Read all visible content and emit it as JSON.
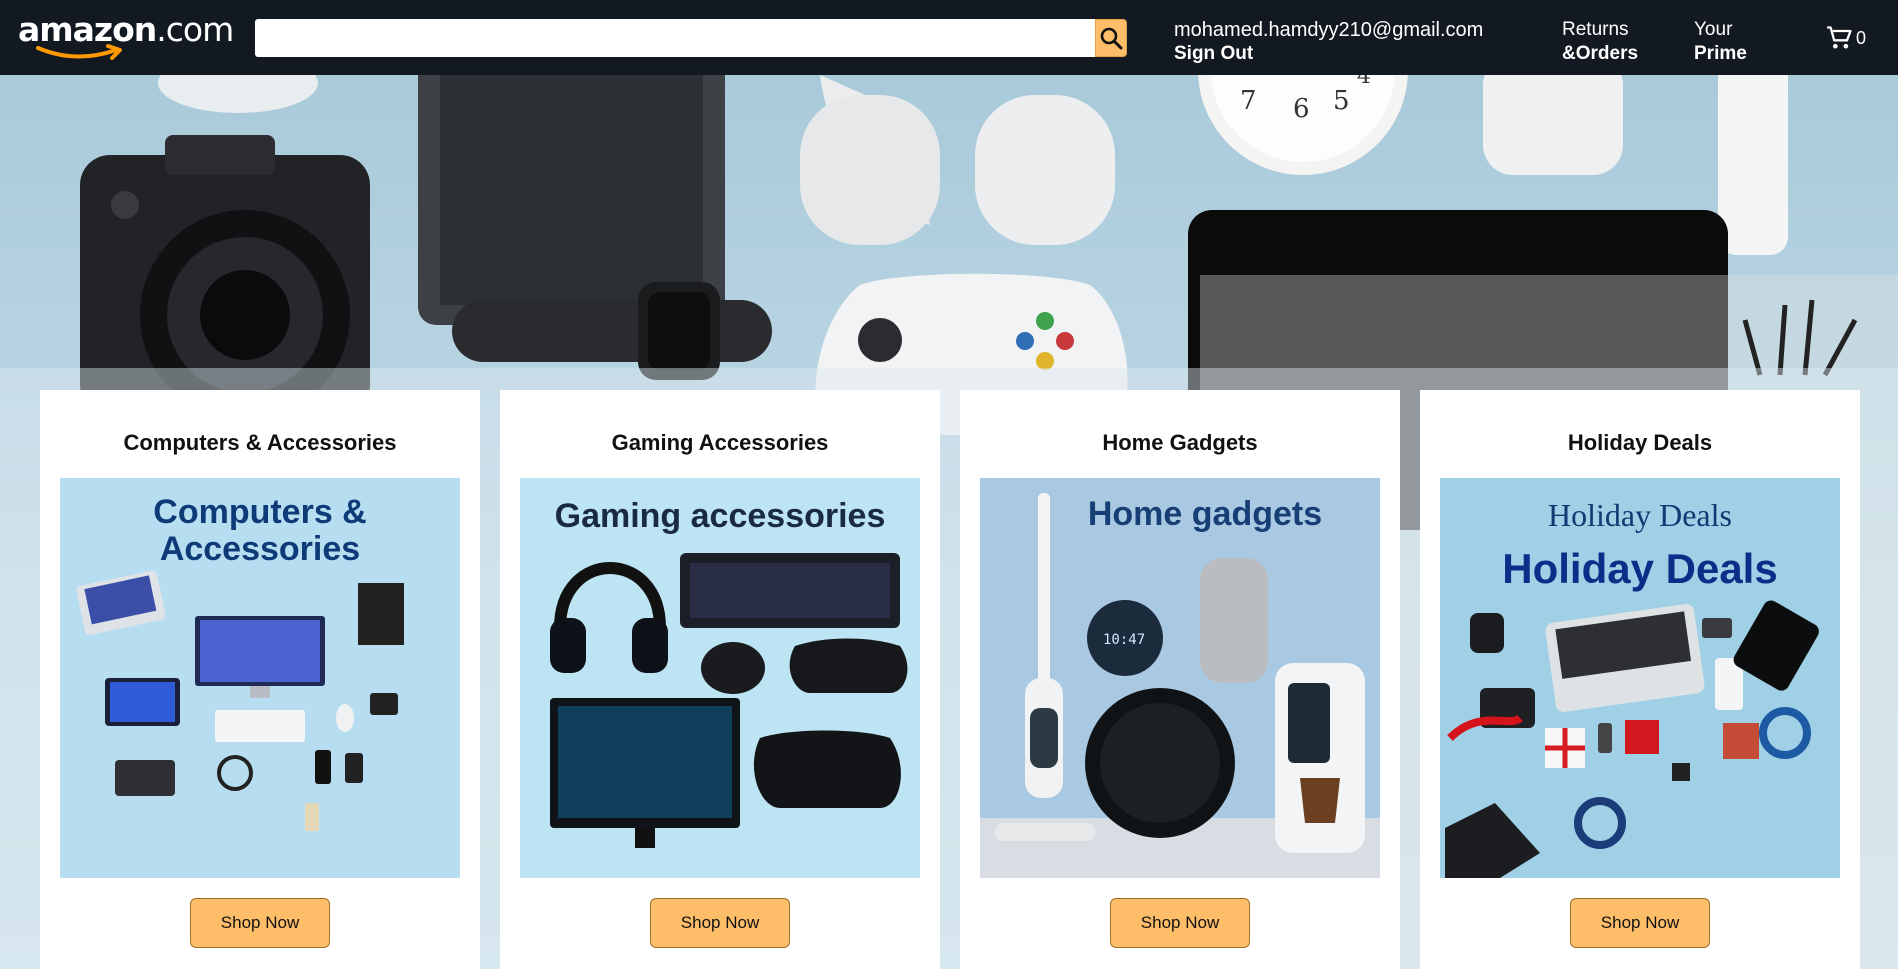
{
  "header": {
    "logo_name": "amazon",
    "logo_suffix": ".com",
    "search": {
      "value": "",
      "placeholder": ""
    },
    "account": {
      "email": "mohamed.hamdyy210@gmail.com",
      "action": "Sign Out"
    },
    "returns": {
      "line1": "Returns",
      "line2": "&Orders"
    },
    "prime": {
      "line1": "Your",
      "line2": "Prime"
    },
    "cart": {
      "count": "0"
    }
  },
  "cards": [
    {
      "title": "Computers & Accessories",
      "image_heading_line1": "Computers &",
      "image_heading_line2": "Accessories",
      "button": "Shop Now"
    },
    {
      "title": "Gaming Accessories",
      "image_heading_line1": "Gaming accessories",
      "button": "Shop Now"
    },
    {
      "title": "Home Gadgets",
      "image_heading_line1": "Home gadgets",
      "button": "Shop Now"
    },
    {
      "title": "Holiday Deals",
      "image_heading_line1": "Holiday Deals",
      "image_heading_line2": "Holiday Deals",
      "button": "Shop Now"
    }
  ],
  "colors": {
    "header_bg": "#131921",
    "accent": "#febd69",
    "logo_smile": "#f90",
    "hero_bg": "#a9cad9"
  }
}
